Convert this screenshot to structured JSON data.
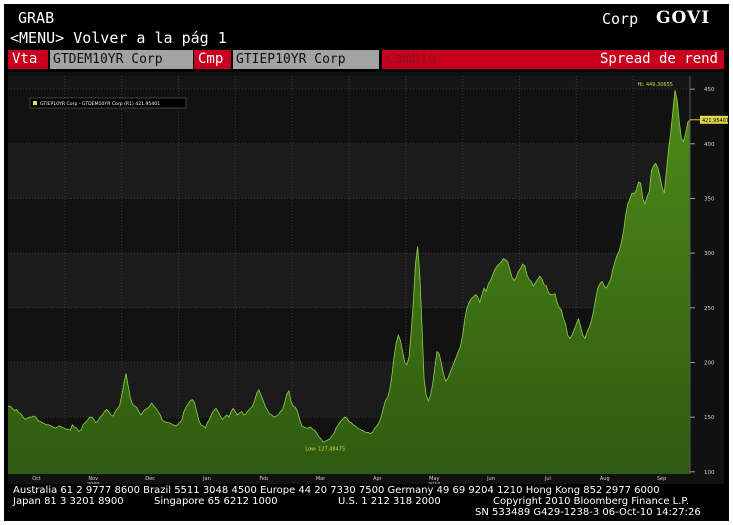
{
  "header": {
    "app_name": "GRAB",
    "menu_line": "<MENU> Volver a la pág 1",
    "market_sector": "Corp",
    "function_code": "GOVI"
  },
  "controls": {
    "vta_label": "Vta",
    "vta_value": "GTDEM10YR Corp",
    "cmp_label": "Cmp",
    "cmp_value": "GTIEP10YR Corp",
    "cambio_label": "Cambio",
    "spread_label": "Spread de rend"
  },
  "chart_data": {
    "type": "area",
    "legend": "GTIEP10YR Corp - GTDEM10YR Corp (R1) 421.95401",
    "last_value_tag": "421.95401",
    "high_label": "Hi: 449.30655",
    "low_label": "Low: 127.48475",
    "y_ticks": [
      100,
      150,
      200,
      250,
      300,
      350,
      400,
      450
    ],
    "ylim": [
      98,
      462
    ],
    "x_months": [
      "Oct",
      "Nov",
      "Dec",
      "Jan",
      "Feb",
      "Mar",
      "Apr",
      "May",
      "Jun",
      "Jul",
      "Aug",
      "Sep"
    ],
    "x_years": [
      "2009",
      "2010"
    ],
    "grid": true,
    "series": [
      {
        "values": [
          160,
          160,
          158,
          156,
          157,
          154,
          153,
          150,
          148,
          149,
          150,
          150,
          151,
          150,
          147,
          146,
          145,
          144,
          143,
          143,
          142,
          141,
          140,
          141,
          142,
          141,
          140,
          139,
          139,
          138,
          143,
          141,
          140,
          137,
          138,
          143,
          145,
          147,
          150,
          150,
          148,
          145,
          147,
          150,
          152,
          155,
          157,
          155,
          152,
          151,
          155,
          158,
          160,
          170,
          180,
          190,
          179,
          168,
          162,
          160,
          159,
          155,
          152,
          155,
          157,
          158,
          160,
          163,
          160,
          158,
          155,
          152,
          147,
          146,
          145,
          145,
          144,
          143,
          142,
          143,
          145,
          147,
          155,
          159,
          162,
          165,
          166,
          163,
          155,
          147,
          143,
          142,
          140,
          145,
          148,
          153,
          156,
          158,
          155,
          151,
          148,
          150,
          152,
          150,
          155,
          158,
          155,
          152,
          154,
          155,
          152,
          153,
          156,
          158,
          160,
          165,
          172,
          175,
          170,
          165,
          160,
          156,
          153,
          152,
          150,
          151,
          152,
          155,
          157,
          163,
          171,
          174,
          164,
          160,
          159,
          155,
          148,
          142,
          141,
          140,
          140,
          141,
          139,
          138,
          135,
          132,
          130,
          127,
          128,
          129,
          130,
          133,
          135,
          140,
          143,
          146,
          148,
          150,
          149,
          146,
          145,
          143,
          142,
          140,
          139,
          138,
          137,
          136,
          136,
          135,
          136,
          140,
          142,
          145,
          150,
          158,
          165,
          168,
          175,
          188,
          205,
          218,
          225,
          220,
          210,
          200,
          198,
          205,
          228,
          255,
          290,
          306,
          280,
          235,
          185,
          170,
          165,
          170,
          180,
          195,
          210,
          208,
          200,
          190,
          183,
          185,
          190,
          195,
          200,
          205,
          210,
          215,
          225,
          240,
          250,
          255,
          258,
          260,
          262,
          260,
          255,
          262,
          268,
          265,
          272,
          275,
          280,
          285,
          288,
          290,
          292,
          295,
          294,
          292,
          285,
          278,
          275,
          278,
          283,
          286,
          290,
          288,
          280,
          276,
          274,
          270,
          273,
          276,
          279,
          276,
          271,
          270,
          264,
          262,
          262,
          263,
          255,
          250,
          248,
          240,
          235,
          225,
          222,
          225,
          230,
          235,
          240,
          233,
          225,
          222,
          228,
          232,
          238,
          247,
          258,
          268,
          272,
          274,
          270,
          268,
          272,
          276,
          285,
          292,
          298,
          302,
          310,
          320,
          335,
          345,
          350,
          355,
          354,
          358,
          365,
          364,
          350,
          345,
          352,
          356,
          375,
          380,
          382,
          378,
          370,
          360,
          355,
          375,
          395,
          410,
          430,
          449,
          440,
          420,
          405,
          402,
          410,
          420,
          421.95
        ]
      }
    ]
  },
  "footer": {
    "line1": "Australia 61 2 9777 8600 Brazil 5511 3048 4500 Europe 44 20 7330 7500 Germany 49 69 9204 1210 Hong Kong 852 2977 6000",
    "line2a": "Japan 81 3 3201 8900",
    "line2b": "Singapore 65 6212 1000",
    "line2c": "U.S. 1 212 318 2000",
    "line2d": "Copyright 2010 Bloomberg Finance L.P.",
    "line3": "SN 533489 G429-1238-3 06-Oct-10 14:27:26"
  }
}
